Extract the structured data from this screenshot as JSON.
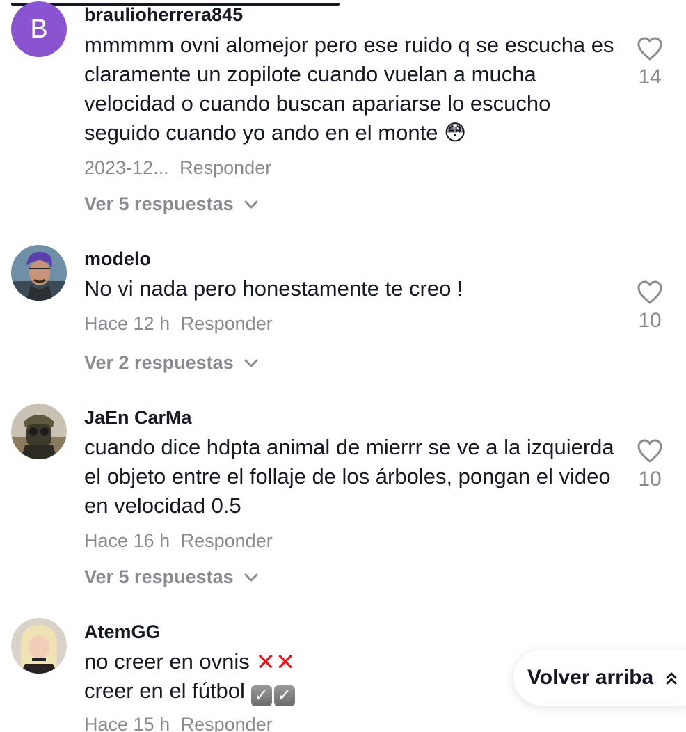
{
  "comments": [
    {
      "avatar_letter": "B",
      "avatar_color": "#8a54d1",
      "username": "braulioherrera845",
      "text": "mmmmm ovni alomejor pero ese ruido q se escucha es claramente un zopilote cuando vuelan a mucha velocidad o cuando buscan apariarse lo escucho seguido cuando yo ando en el monte 😳",
      "time": "2023-12...",
      "reply_label": "Responder",
      "view_replies": "Ver 5 respuestas",
      "likes": "14"
    },
    {
      "username": "modelo",
      "text": "No vi nada pero honestamente te creo !",
      "time": "Hace 12 h",
      "reply_label": "Responder",
      "view_replies": "Ver 2 respuestas",
      "likes": "10"
    },
    {
      "username": "JaEn CarMa",
      "text": "cuando dice hdpta animal de mierrr se ve a la izquierda el objeto entre el follaje de los árboles, pongan el video en velocidad 0.5",
      "time": "Hace 16 h",
      "reply_label": "Responder",
      "view_replies": "Ver 5 respuestas",
      "likes": "10"
    },
    {
      "username": "AtemGG",
      "text_line1": "no creer en ovnis",
      "text_line2": "creer en el fútbol",
      "time": "Hace 15 h",
      "reply_label": "Responder"
    }
  ],
  "back_to_top": {
    "label": "Volver arriba"
  },
  "icons": {
    "like": "heart-outline-icon",
    "expand": "chevron-down-icon",
    "back_to_top": "double-chevron-up-icon"
  }
}
